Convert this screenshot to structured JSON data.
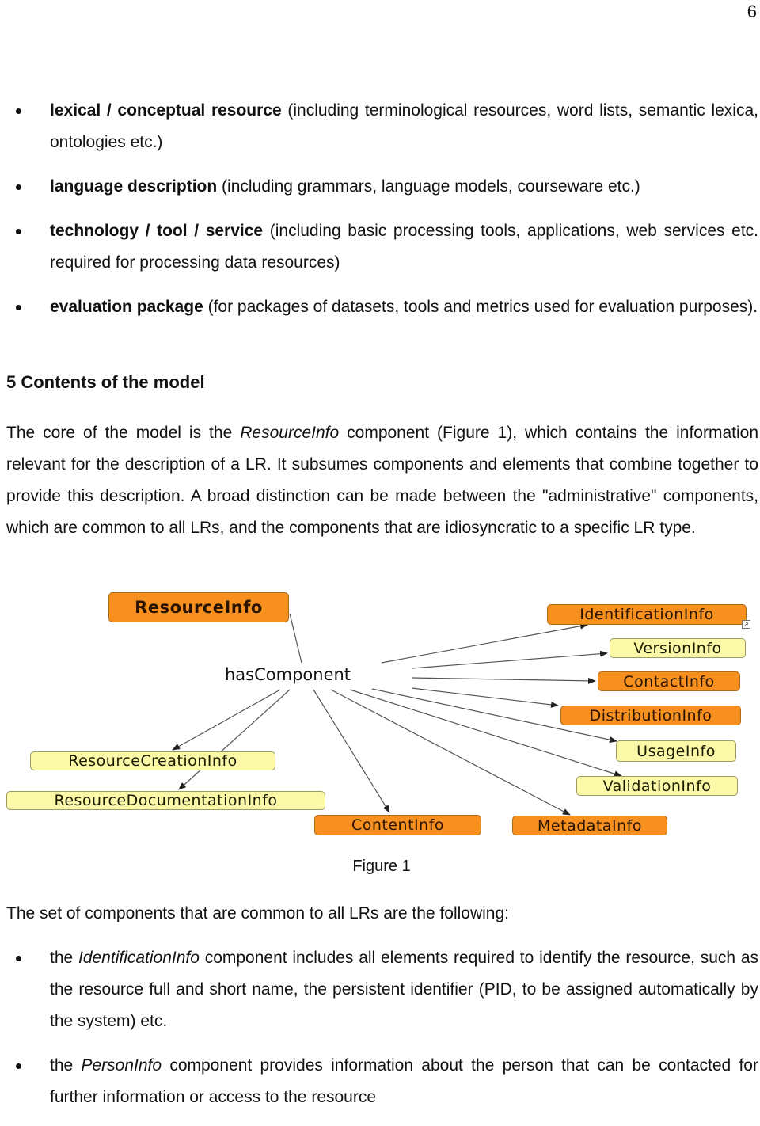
{
  "page": {
    "number": "6"
  },
  "resource_types": [
    {
      "term": "lexical / conceptual resource",
      "desc": " (including terminological resources, word lists, semantic lexica, ontologies etc.)"
    },
    {
      "term": "language description",
      "desc": " (including grammars, language models, courseware etc.)"
    },
    {
      "term": "technology / tool / service",
      "desc": " (including basic processing tools, applications, web services etc. required for processing data resources)"
    },
    {
      "term": "evaluation package",
      "desc": " (for packages of datasets, tools and metrics used for evaluation purposes)."
    }
  ],
  "section": {
    "heading": "5 Contents of the model",
    "para_pre": "The core of the model is the ",
    "para_em": "ResourceInfo",
    "para_post": " component (Figure 1), which contains the information relevant for the description of a LR. It subsumes components and elements that combine together to provide this description. A broad distinction can be made between the \"administrative\" components, which are common to all LRs, and the components that are idiosyncratic to a specific LR type."
  },
  "figure": {
    "caption": "Figure 1",
    "root": "ResourceInfo",
    "relation": "hasComponent",
    "components": [
      {
        "label": "IdentificationInfo",
        "style": "orange",
        "shortcut": true
      },
      {
        "label": "VersionInfo",
        "style": "yellow"
      },
      {
        "label": "ContactInfo",
        "style": "orange"
      },
      {
        "label": "DistributionInfo",
        "style": "orange"
      },
      {
        "label": "UsageInfo",
        "style": "yellow"
      },
      {
        "label": "ValidationInfo",
        "style": "yellow"
      },
      {
        "label": "MetadataInfo",
        "style": "orange"
      },
      {
        "label": "ContentInfo",
        "style": "orange"
      },
      {
        "label": "ResourceCreationInfo",
        "style": "yellow"
      },
      {
        "label": "ResourceDocumentationInfo",
        "style": "yellow"
      }
    ],
    "colors": {
      "orange": "#f7901e",
      "yellow": "#fbf9a8"
    }
  },
  "common_components": {
    "intro": "The set of components that are common to all LRs are the following:",
    "items": [
      {
        "pre": "the ",
        "em": "IdentificationInfo",
        "post": " component includes all elements required to identify the resource, such as the resource full and short name, the persistent identifier (PID, to be assigned automatically by the system) etc."
      },
      {
        "pre": "the ",
        "em": "PersonInfo",
        "post": " component provides information about the person that can be contacted for further information or access to the resource"
      }
    ]
  }
}
